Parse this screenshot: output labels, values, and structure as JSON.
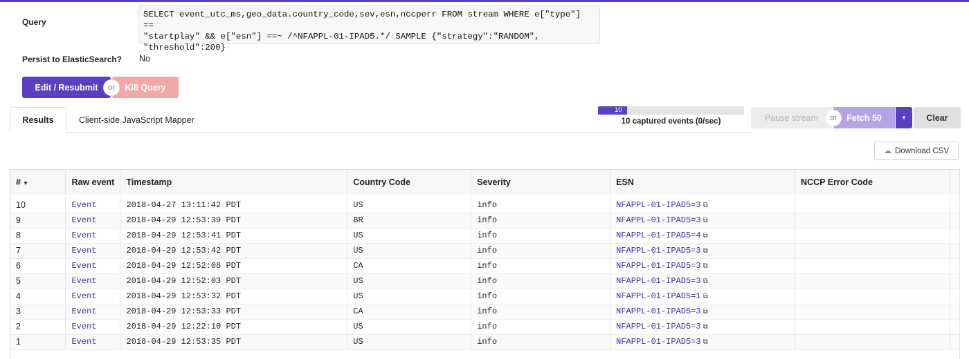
{
  "query": {
    "label": "Query",
    "text": "SELECT event_utc_ms,geo_data.country_code,sev,esn,nccperr FROM stream WHERE e[\"type\"] ==\n\"startplay\" && e[\"esn\"] ==~ /^NFAPPL-01-IPAD5.*/ SAMPLE {\"strategy\":\"RANDOM\",\n\"threshold\":200}"
  },
  "persist": {
    "label": "Persist to ElasticSearch?",
    "value": "No"
  },
  "actions": {
    "edit_label": "Edit / Resubmit",
    "or": "or",
    "kill_label": "Kill Query"
  },
  "tabs": [
    {
      "label": "Results",
      "active": true
    },
    {
      "label": "Client-side JavaScript Mapper",
      "active": false
    }
  ],
  "progress": {
    "value": "10",
    "fraction": 0.2,
    "caption": "10 captured events (0/sec)"
  },
  "stream_controls": {
    "pause_label": "Pause stream",
    "or": "or",
    "fetch_label": "Fetch 50",
    "caret": "▼",
    "clear_label": "Clear"
  },
  "download": {
    "label": "Download CSV",
    "icon": "cloud-download-icon"
  },
  "table": {
    "columns": [
      "#",
      "Raw event",
      "Timestamp",
      "Country Code",
      "Severity",
      "ESN",
      "NCCP Error Code"
    ],
    "rows": [
      {
        "num": "10",
        "raw": "Event",
        "timestamp": "2018-04-27 13:11:42 PDT",
        "country": "US",
        "severity": "info",
        "esn": "NFAPPL-01-IPAD5=3",
        "nccp": ""
      },
      {
        "num": "9",
        "raw": "Event",
        "timestamp": "2018-04-29 12:53:39 PDT",
        "country": "BR",
        "severity": "info",
        "esn": "NFAPPL-01-IPAD5=3",
        "nccp": ""
      },
      {
        "num": "8",
        "raw": "Event",
        "timestamp": "2018-04-29 12:53:41 PDT",
        "country": "US",
        "severity": "info",
        "esn": "NFAPPL-01-IPAD5=4",
        "nccp": ""
      },
      {
        "num": "7",
        "raw": "Event",
        "timestamp": "2018-04-29 12:53:42 PDT",
        "country": "US",
        "severity": "info",
        "esn": "NFAPPL-01-IPAD5=3",
        "nccp": ""
      },
      {
        "num": "6",
        "raw": "Event",
        "timestamp": "2018-04-29 12:52:08 PDT",
        "country": "CA",
        "severity": "info",
        "esn": "NFAPPL-01-IPAD5=3",
        "nccp": ""
      },
      {
        "num": "5",
        "raw": "Event",
        "timestamp": "2018-04-29 12:52:03 PDT",
        "country": "US",
        "severity": "info",
        "esn": "NFAPPL-01-IPAD5=3",
        "nccp": ""
      },
      {
        "num": "4",
        "raw": "Event",
        "timestamp": "2018-04-29 12:53:32 PDT",
        "country": "US",
        "severity": "info",
        "esn": "NFAPPL-01-IPAD5=1",
        "nccp": ""
      },
      {
        "num": "3",
        "raw": "Event",
        "timestamp": "2018-04-29 12:53:33 PDT",
        "country": "CA",
        "severity": "info",
        "esn": "NFAPPL-01-IPAD5=3",
        "nccp": ""
      },
      {
        "num": "2",
        "raw": "Event",
        "timestamp": "2018-04-29 12:22:10 PDT",
        "country": "US",
        "severity": "info",
        "esn": "NFAPPL-01-IPAD5=3",
        "nccp": ""
      },
      {
        "num": "1",
        "raw": "Event",
        "timestamp": "2018-04-29 12:53:35 PDT",
        "country": "US",
        "severity": "info",
        "esn": "NFAPPL-01-IPAD5=3",
        "nccp": ""
      }
    ]
  },
  "colors": {
    "accent": "#5a3fc0",
    "kill": "#f2a8a6",
    "fetch": "#b5a5e6",
    "link": "#3a2fa0"
  }
}
